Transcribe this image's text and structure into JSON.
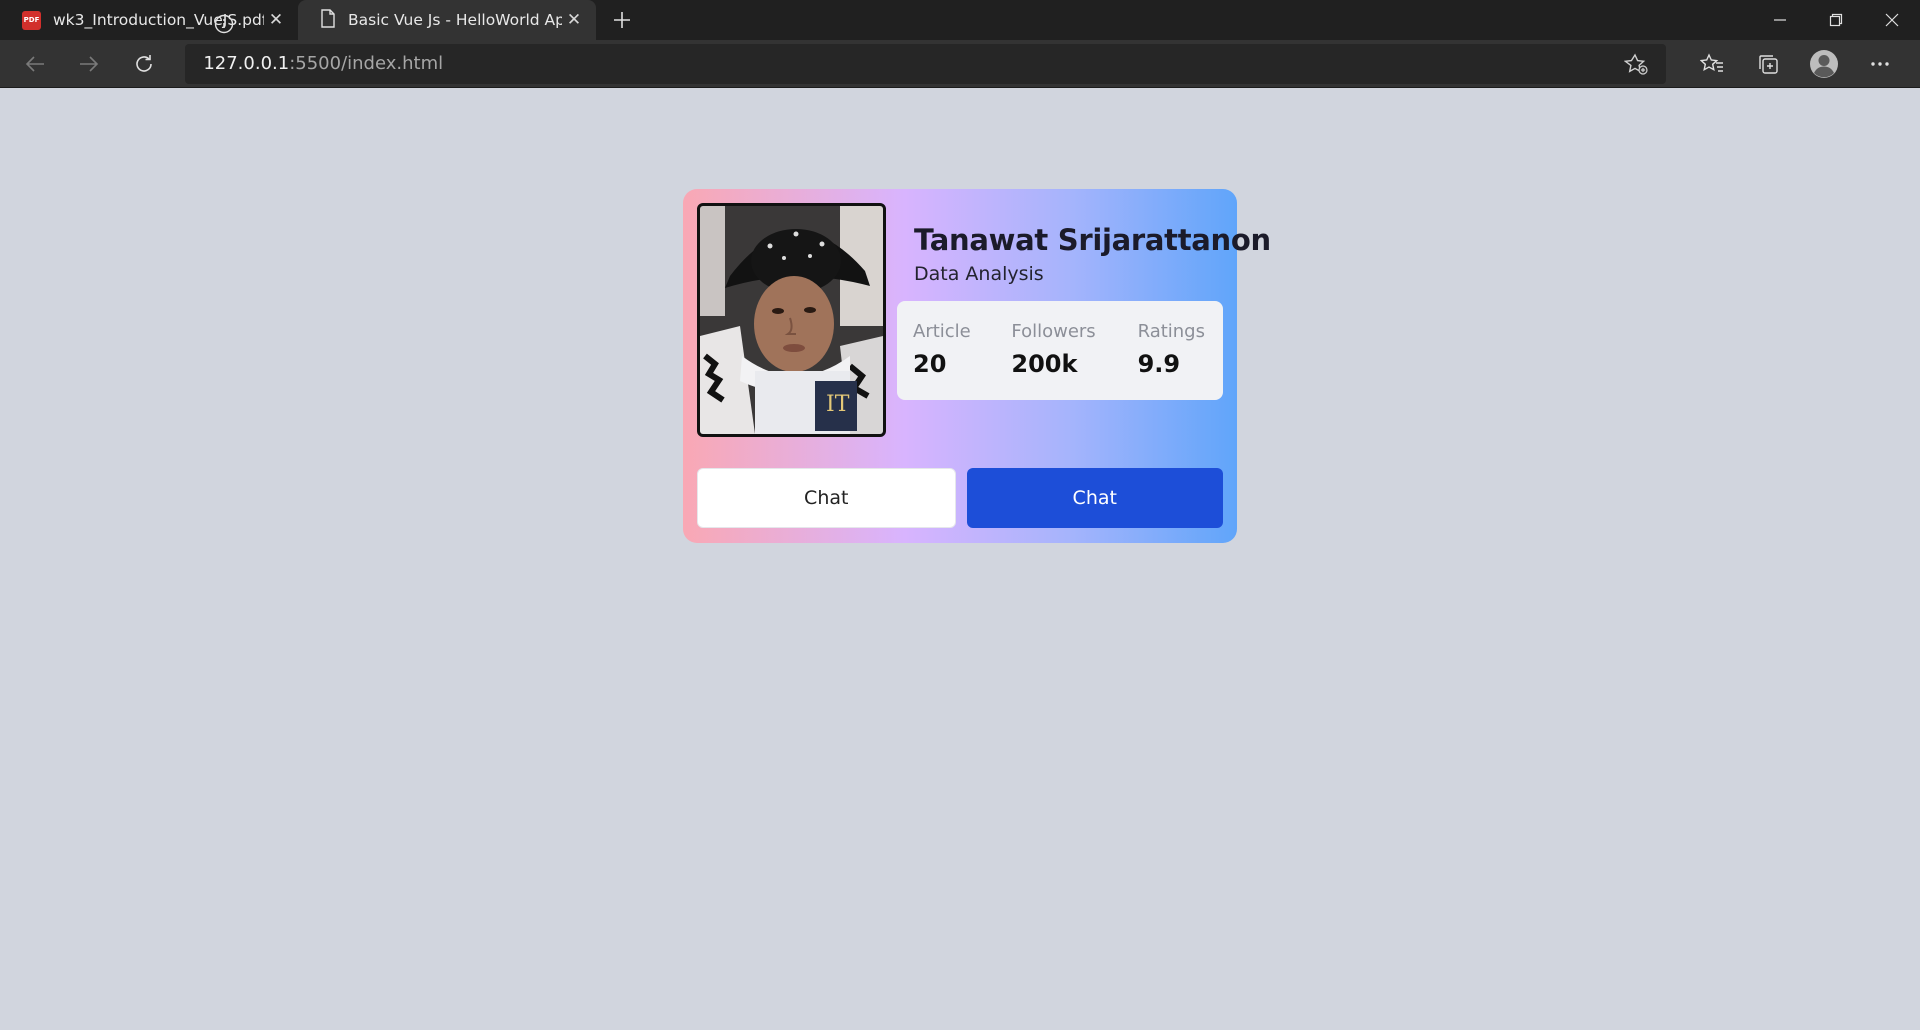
{
  "browser": {
    "tabs": [
      {
        "title": "wk3_Introduction_VueJS.pdf",
        "icon": "pdf-icon",
        "badge": "PDF",
        "active": false
      },
      {
        "title": "Basic Vue Js - HelloWorld App",
        "icon": "page-icon",
        "active": true
      }
    ],
    "address": {
      "host": "127.0.0.1",
      "path": ":5500/index.html"
    }
  },
  "profile": {
    "name": "Tanawat Srijarattanon",
    "role": "Data Analysis",
    "stats": [
      {
        "label": "Article",
        "value": "20"
      },
      {
        "label": "Followers",
        "value": "200k"
      },
      {
        "label": "Ratings",
        "value": "9.9"
      }
    ],
    "buttons": {
      "secondary": "Chat",
      "primary": "Chat"
    }
  },
  "colors": {
    "page_bg": "#d1d5de",
    "card_gradient": [
      "#f9a8b4",
      "#d8b4fe",
      "#a5b4fc",
      "#60a5fa"
    ],
    "primary_button": "#1d4ed8"
  }
}
